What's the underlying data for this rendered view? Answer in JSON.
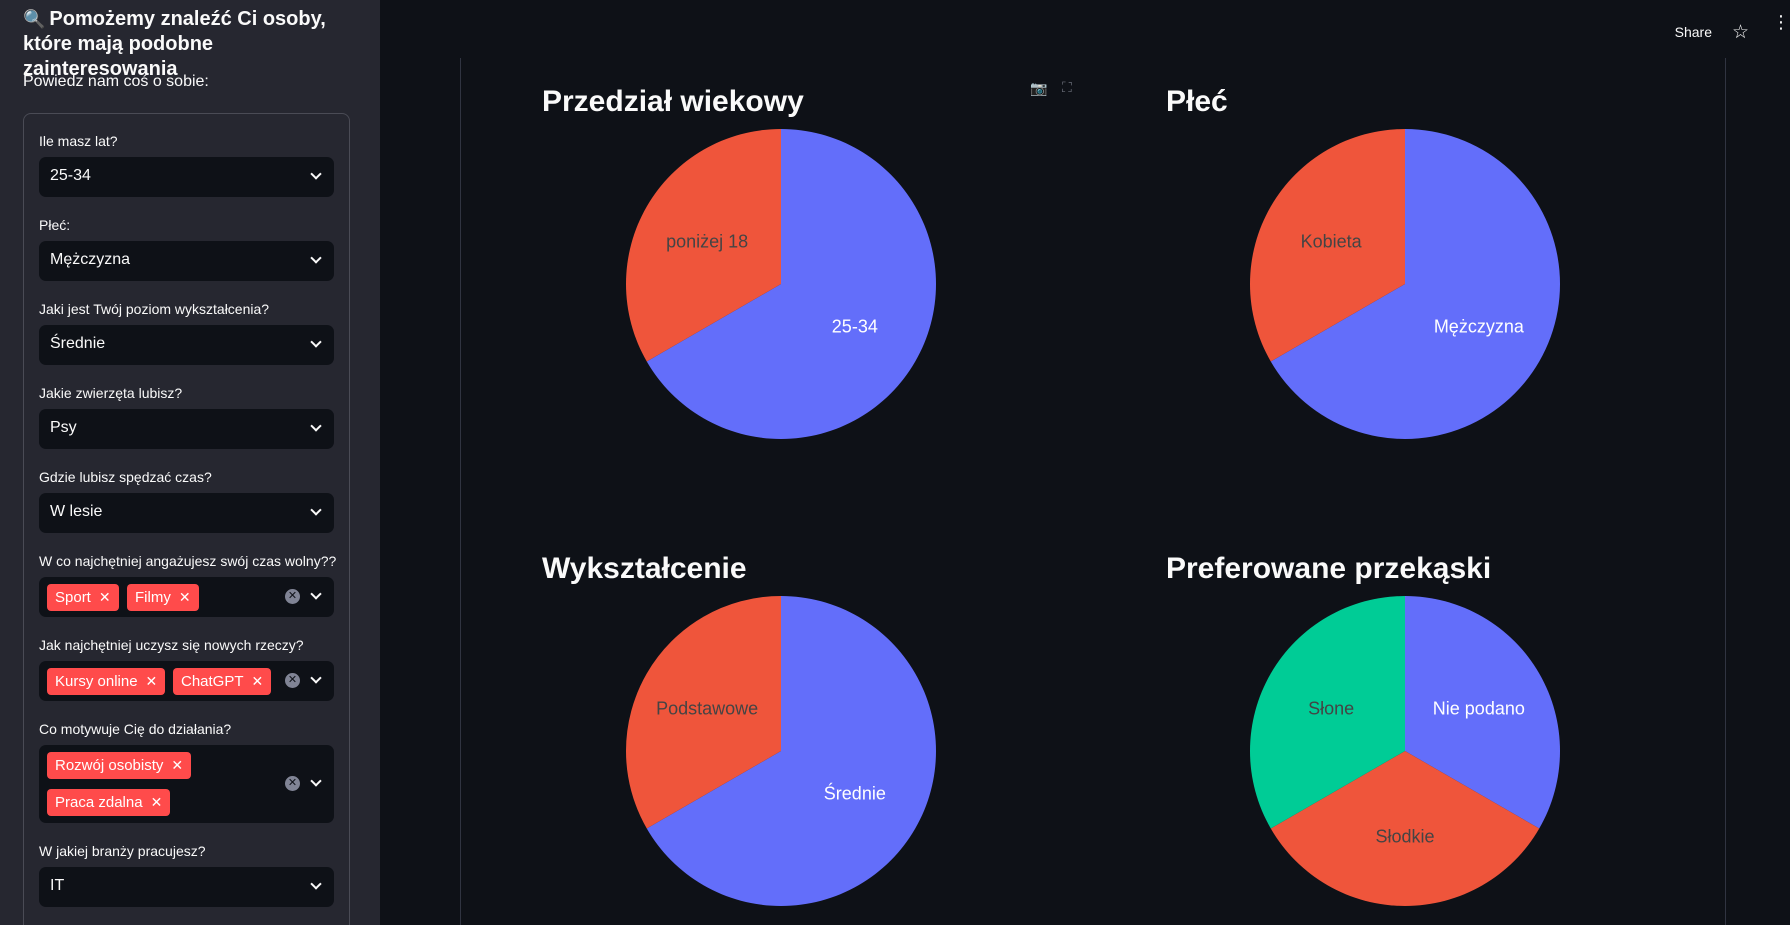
{
  "sidebar": {
    "title": "Pomożemy znaleźć Ci osoby, które mają podobne zainteresowania",
    "title_icon": "search-icon",
    "subtitle": "Powiedz nam coś o sobie:",
    "fields": [
      {
        "label": "Ile masz lat?",
        "value": "25-34"
      },
      {
        "label": "Płeć:",
        "value": "Mężczyzna"
      },
      {
        "label": "Jaki jest Twój poziom wykształcenia?",
        "value": "Średnie"
      },
      {
        "label": "Jakie zwierzęta lubisz?",
        "value": "Psy"
      },
      {
        "label": "Gdzie lubisz spędzać czas?",
        "value": "W lesie"
      },
      {
        "label": "W co najchętniej angażujesz swój czas wolny??",
        "tags": [
          "Sport",
          "Filmy"
        ]
      },
      {
        "label": "Jak najchętniej uczysz się nowych rzeczy?",
        "tags": [
          "Kursy online",
          "ChatGPT"
        ]
      },
      {
        "label": "Co motywuje Cię do działania?",
        "tags": [
          "Rozwój osobisty",
          "Praca zdalna"
        ]
      },
      {
        "label": "W jakiej branży pracujesz?",
        "value": "IT"
      }
    ]
  },
  "topbar": {
    "share": "Share"
  },
  "colors": {
    "blue": "#636efa",
    "red": "#ef553b",
    "green": "#00cc96",
    "tag": "#ff4b4b"
  },
  "chart_data": [
    {
      "type": "pie",
      "title": "Przedział wiekowy",
      "labels": [
        "25-34",
        "poniżej 18"
      ],
      "values": [
        2,
        1
      ]
    },
    {
      "type": "pie",
      "title": "Płeć",
      "labels": [
        "Mężczyzna",
        "Kobieta"
      ],
      "values": [
        2,
        1
      ]
    },
    {
      "type": "pie",
      "title": "Wykształcenie",
      "labels": [
        "Średnie",
        "Podstawowe"
      ],
      "values": [
        2,
        1
      ]
    },
    {
      "type": "pie",
      "title": "Preferowane przekąski",
      "labels": [
        "Nie podano",
        "Słodkie",
        "Słone"
      ],
      "values": [
        1,
        1,
        1
      ]
    }
  ]
}
